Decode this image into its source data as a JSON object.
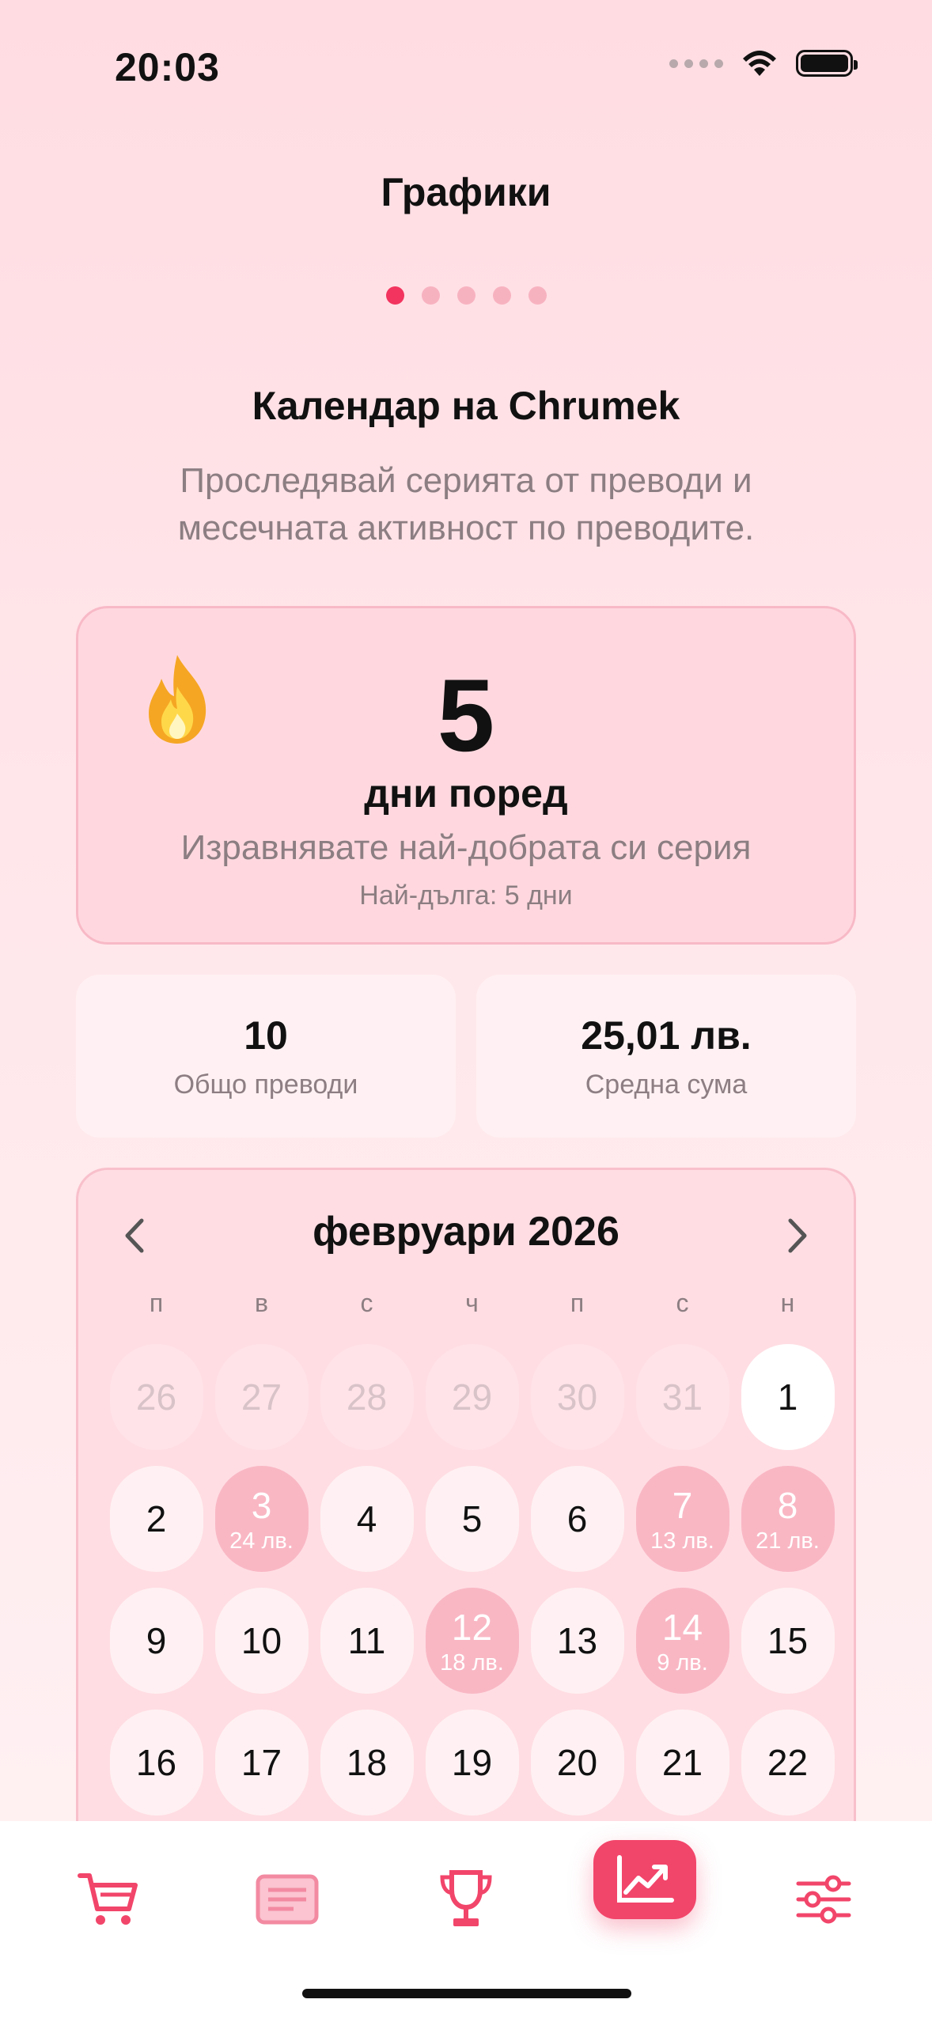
{
  "status_bar": {
    "time": "20:03"
  },
  "nav": {
    "title": "Графики"
  },
  "pager": {
    "count": 5,
    "active_index": 0
  },
  "section": {
    "title": "Календар на Chrumek",
    "subtitle": "Проследявай серията от преводи и месечната активност по преводите."
  },
  "streak": {
    "number": "5",
    "label": "дни поред",
    "message": "Изравнявате най-добрата си серия",
    "best": "Най-дълга: 5 дни"
  },
  "stats": {
    "total_value": "10",
    "total_label": "Общо преводи",
    "avg_value": "25,01 лв.",
    "avg_label": "Средна сума"
  },
  "calendar": {
    "month_label": "февруари 2026",
    "weekdays": [
      "п",
      "в",
      "с",
      "ч",
      "п",
      "с",
      "н"
    ],
    "days": [
      {
        "n": "26",
        "state": "muted"
      },
      {
        "n": "27",
        "state": "muted"
      },
      {
        "n": "28",
        "state": "muted"
      },
      {
        "n": "29",
        "state": "muted"
      },
      {
        "n": "30",
        "state": "muted"
      },
      {
        "n": "31",
        "state": "muted"
      },
      {
        "n": "1",
        "state": "white"
      },
      {
        "n": "2"
      },
      {
        "n": "3",
        "state": "active",
        "amt": "24 лв."
      },
      {
        "n": "4"
      },
      {
        "n": "5"
      },
      {
        "n": "6"
      },
      {
        "n": "7",
        "state": "active",
        "amt": "13 лв."
      },
      {
        "n": "8",
        "state": "active",
        "amt": "21 лв."
      },
      {
        "n": "9"
      },
      {
        "n": "10"
      },
      {
        "n": "11"
      },
      {
        "n": "12",
        "state": "active",
        "amt": "18 лв."
      },
      {
        "n": "13"
      },
      {
        "n": "14",
        "state": "active",
        "amt": "9 лв."
      },
      {
        "n": "15"
      },
      {
        "n": "16"
      },
      {
        "n": "17"
      },
      {
        "n": "18"
      },
      {
        "n": "19"
      },
      {
        "n": "20"
      },
      {
        "n": "21"
      },
      {
        "n": "22"
      }
    ]
  },
  "tabs": [
    {
      "icon": "cart-icon",
      "active": false
    },
    {
      "icon": "list-icon",
      "active": false
    },
    {
      "icon": "trophy-icon",
      "active": false
    },
    {
      "icon": "chart-icon",
      "active": true
    },
    {
      "icon": "sliders-icon",
      "active": false
    }
  ],
  "colors": {
    "accent": "#f2456a",
    "active_day": "#f9b7c4",
    "pager_active": "#f2345e",
    "pager_inactive": "#f7b2c0"
  }
}
